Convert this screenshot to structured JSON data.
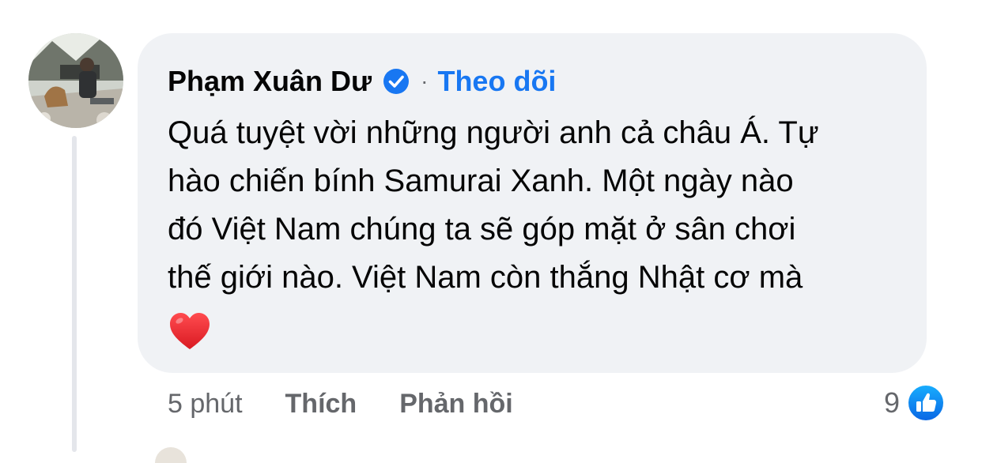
{
  "comment": {
    "author": "Phạm Xuân Dư",
    "follow_label": "Theo dõi",
    "separator": "·",
    "text": "Quá tuyệt vời những người anh cả châu Á. Tự\nhào chiến bính Samurai Xanh. Một ngày nào\nđó Việt Nam chúng ta sẽ góp mặt ở sân chơi\nthế giới nào. Việt Nam còn thắng Nhật cơ mà",
    "emoji": "heart",
    "timestamp": "5 phút",
    "like_action": "Thích",
    "reply_action": "Phản hồi",
    "reaction_count": "9",
    "reaction_icon": "thumbs-up-icon",
    "verified_icon": "verified-badge-icon"
  },
  "colors": {
    "bubble": "#f0f2f5",
    "accent": "#1877f2",
    "muted": "#65676b",
    "heart": "#e0282e"
  }
}
